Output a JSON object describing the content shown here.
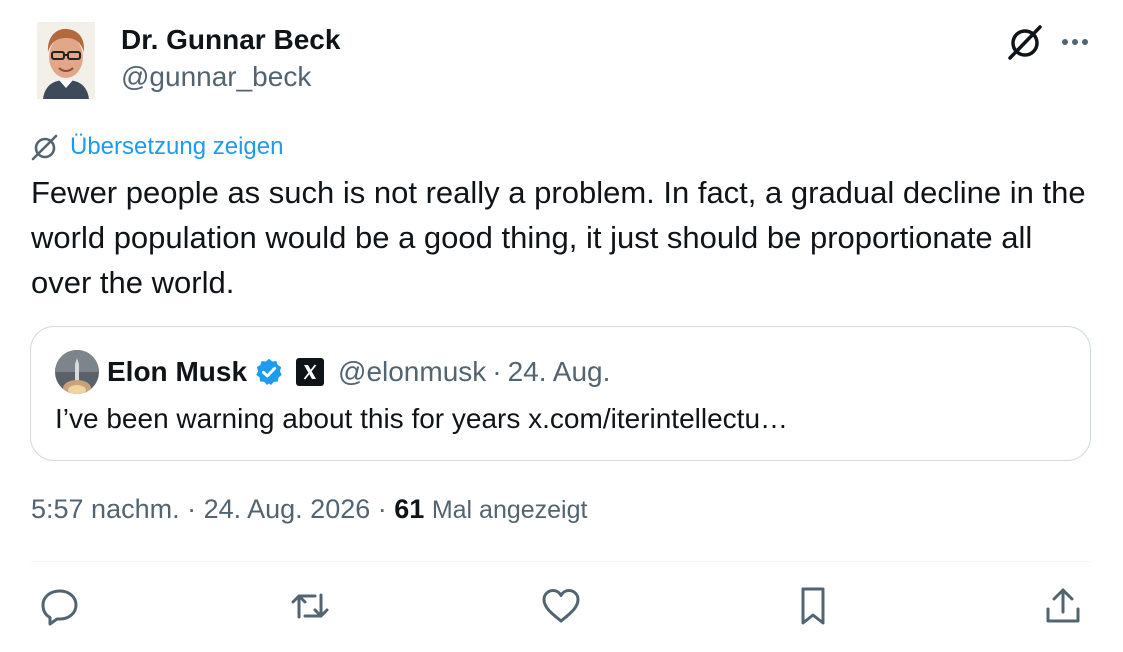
{
  "author": {
    "name": "Dr. Gunnar Beck",
    "handle": "@gunnar_beck"
  },
  "translate": {
    "label": "Übersetzung zeigen",
    "icon": "grok-icon"
  },
  "tweet": {
    "text": "Fewer people as such is not really a problem. In fact, a gradual decline in the world population would be a good thing, it just should be proportionate all over the world."
  },
  "quote": {
    "name": "Elon Musk",
    "verified_icon": "verified-badge-icon",
    "affiliation_icon": "x-logo-icon",
    "handle": "@elonmusk",
    "separator": "·",
    "date": "24. Aug.",
    "text": "I’ve been warning about this for years x.com/iterintellectu…"
  },
  "meta": {
    "time": "5:57 nachm.",
    "separator1": " · ",
    "date": "24. Aug. 2026",
    "separator2": " · ",
    "views_count": "61",
    "views_label": "Mal angezeigt"
  },
  "header_icons": {
    "grok": "grok-icon",
    "more": "more-icon"
  },
  "actions": [
    {
      "name": "reply",
      "icon": "reply-icon"
    },
    {
      "name": "retweet",
      "icon": "retweet-icon"
    },
    {
      "name": "like",
      "icon": "like-icon"
    },
    {
      "name": "bookmark",
      "icon": "bookmark-icon"
    },
    {
      "name": "share",
      "icon": "share-icon"
    }
  ],
  "colors": {
    "text": "#0f1419",
    "secondary": "#536471",
    "accent": "#1d9bf0",
    "border": "#cfd9de"
  }
}
